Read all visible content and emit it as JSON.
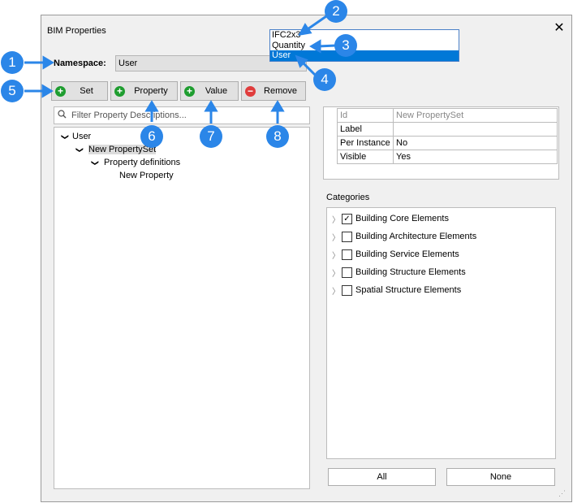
{
  "dialog": {
    "title": "BIM Properties",
    "close": "✕"
  },
  "namespace": {
    "label": "Namespace:",
    "value": "User",
    "options": [
      "IFC2x3",
      "Quantity",
      "User"
    ]
  },
  "toolbar": {
    "set": "Set",
    "property": "Property",
    "value": "Value",
    "remove": "Remove"
  },
  "filter": {
    "placeholder": "Filter Property Descriptions..."
  },
  "tree": {
    "root": "User",
    "set": "New PropertySet",
    "defs": "Property definitions",
    "prop": "New Property"
  },
  "properties": [
    {
      "key": "Id",
      "value": "New PropertySet"
    },
    {
      "key": "Label",
      "value": ""
    },
    {
      "key": "Per Instance",
      "value": "No"
    },
    {
      "key": "Visible",
      "value": "Yes"
    }
  ],
  "categories": {
    "label": "Categories",
    "items": [
      {
        "name": "Building Core Elements",
        "checked": "✓"
      },
      {
        "name": "Building Architecture Elements",
        "checked": ""
      },
      {
        "name": "Building Service Elements",
        "checked": ""
      },
      {
        "name": "Building Structure Elements",
        "checked": ""
      },
      {
        "name": "Spatial Structure Elements",
        "checked": ""
      }
    ]
  },
  "bottom": {
    "all": "All",
    "none": "None"
  },
  "callouts": [
    "1",
    "2",
    "3",
    "4",
    "5",
    "6",
    "7",
    "8"
  ],
  "colors": {
    "callout": "#2b86e8",
    "selection": "#0078d7",
    "add": "#1e9d2f",
    "remove": "#e03c3c"
  }
}
